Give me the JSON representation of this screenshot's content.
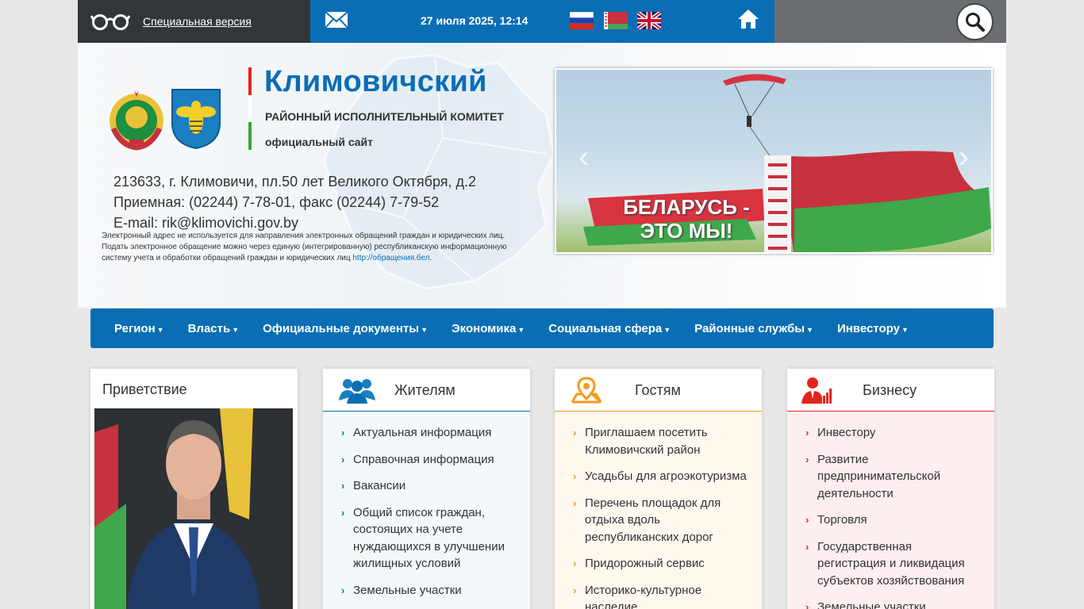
{
  "topbar": {
    "special_version": "Специальная версия",
    "datetime": "27 июля 2025, 12:14",
    "icons": [
      "glasses-icon",
      "mail-icon",
      "flag-ru",
      "flag-by",
      "flag-gb",
      "home-icon",
      "search-icon"
    ]
  },
  "header": {
    "title": "Климовичский",
    "subtitle": "РАЙОННЫЙ ИСПОЛНИТЕЛЬНЫЙ КОМИТЕТ",
    "tagline": "официальный сайт",
    "address": "213633, г. Климовичи, пл.50 лет Великого Октября, д.2",
    "phone": "Приемная: (02244) 7-78-01, факс (02244) 7-79-52",
    "email": "E-mail: rik@klimovichi.gov.by",
    "note": "Электронный адрес не используется для направления электронных обращений граждан и юридических лиц. Подать электронное обращение можно через единую (интегрированную) республиканскую информационную систему учета и обработки обращений граждан и юридических лиц",
    "note_link": "http://обращения.бел",
    "note_end": ".",
    "vbar_colors": [
      "#e3241b",
      "#ffffff",
      "#3aa53a"
    ]
  },
  "slider": {
    "slogan_line1": "БЕЛАРУСЬ -",
    "slogan_line2": "ЭТО МЫ!",
    "prev": "‹",
    "next": "›"
  },
  "nav": {
    "items": [
      "Регион",
      "Власть",
      "Официальные документы",
      "Экономика",
      "Социальная сфера",
      "Районные службы",
      "Инвестору"
    ]
  },
  "cards": {
    "greeting": {
      "title": "Приветствие"
    },
    "residents": {
      "title": "Жителям",
      "accent": "#0a6eb4",
      "items": [
        "Актуальная информация",
        "Справочная информация",
        "Вакансии",
        "Общий список граждан, состоящих на учете нуждающихся в улучшении жилищных условий",
        "Земельные участки"
      ]
    },
    "guests": {
      "title": "Гостям",
      "accent": "#f39a1e",
      "items": [
        "Приглашаем посетить Климовичский район",
        "Усадьбы для агроэкотуризма",
        "Перечень площадок для отдыха вдоль республиканских дорог",
        "Придорожный сервис",
        "Историко-культурное наследие"
      ]
    },
    "business": {
      "title": "Бизнесу",
      "accent": "#e3241b",
      "items": [
        "Инвестору",
        "Развитие предпринимательской деятельности",
        "Торговля",
        "Государственная регистрация и ликвидация субъектов хозяйствования",
        "Земельные участки"
      ]
    }
  }
}
